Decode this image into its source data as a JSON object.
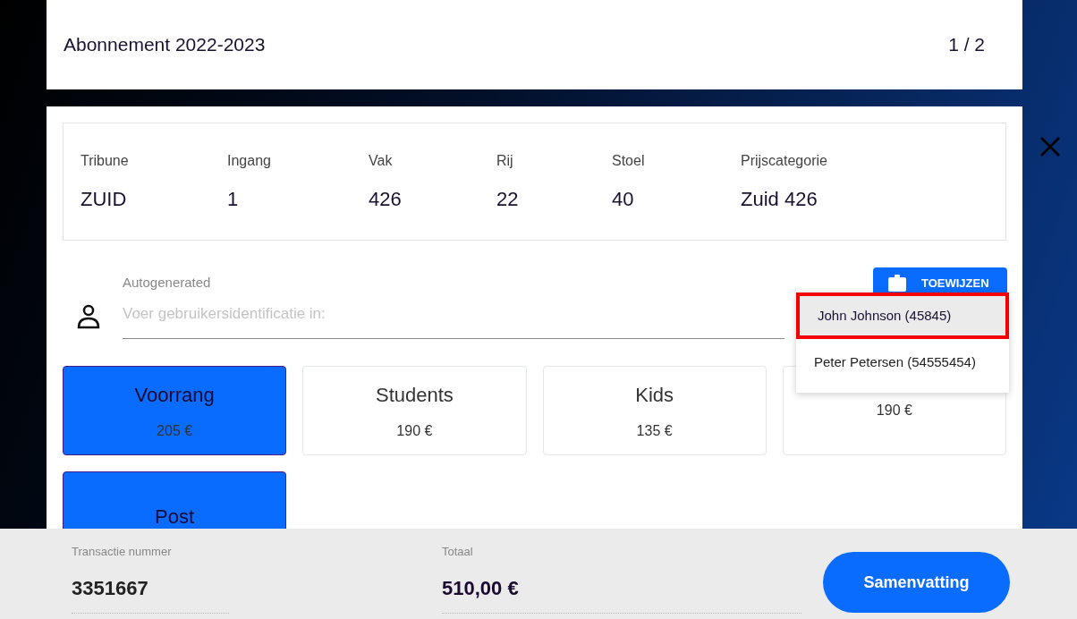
{
  "header": {
    "title": "Abonnement 2022-2023",
    "pager": "1 / 2"
  },
  "seat": [
    {
      "label": "Tribune",
      "value": "ZUID"
    },
    {
      "label": "Ingang",
      "value": "1"
    },
    {
      "label": "Vak",
      "value": "426"
    },
    {
      "label": "Rij",
      "value": "22"
    },
    {
      "label": "Stoel",
      "value": "40"
    },
    {
      "label": "Prijscategorie",
      "value": "Zuid 426"
    }
  ],
  "user_field": {
    "label": "Autogenerated",
    "placeholder": "Voer gebruikersidentificatie in:"
  },
  "assign_button": "TOEWIJZEN",
  "suggestions": [
    {
      "text": "John Johnson (45845)",
      "selected": true
    },
    {
      "text": "Peter Petersen (54555454)",
      "selected": false
    }
  ],
  "price_types": [
    {
      "name": "Voorrang",
      "price": "205 €",
      "selected": true
    },
    {
      "name": "Students",
      "price": "190 €",
      "selected": false
    },
    {
      "name": "Kids",
      "price": "135 €",
      "selected": false
    },
    {
      "price": "190 €",
      "selected": false
    },
    {
      "name": "Post",
      "selected": true
    }
  ],
  "footer": {
    "transaction_label": "Transactie nummer",
    "transaction": "3351667",
    "total_label": "Totaal",
    "total": "510,00 €",
    "summary_button": "Samenvatting"
  }
}
